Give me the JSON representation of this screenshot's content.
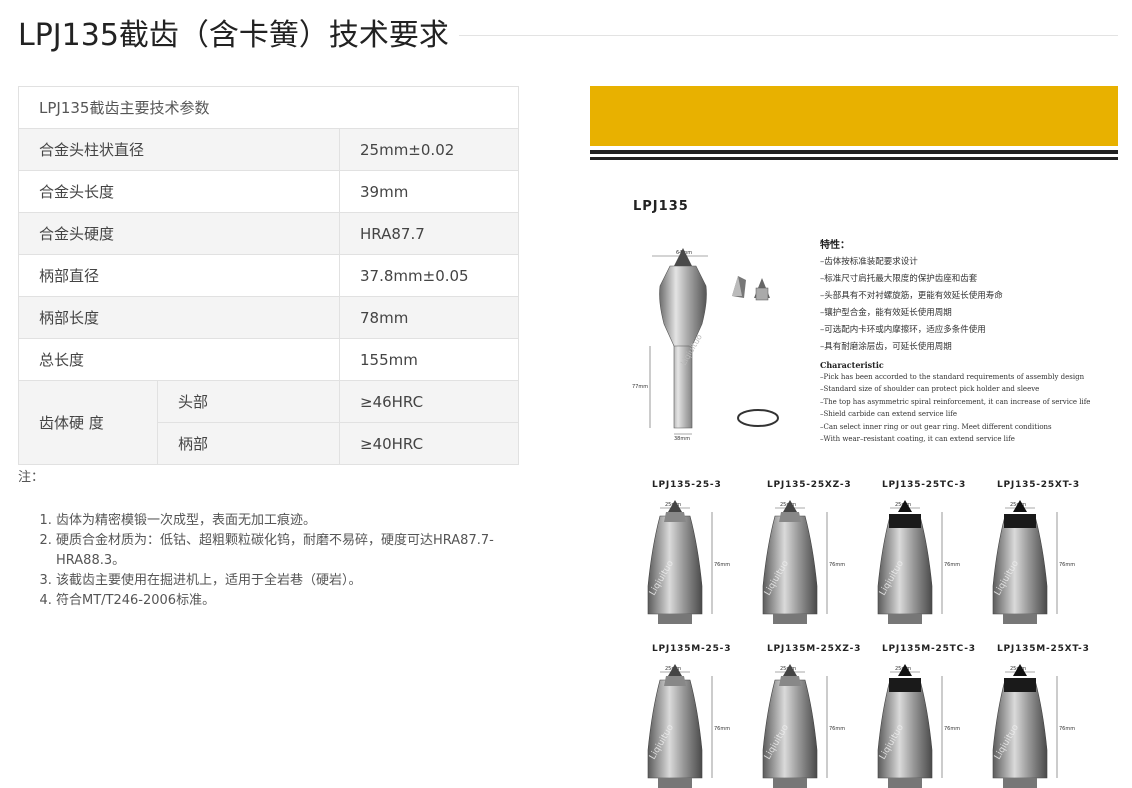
{
  "title": "LPJ135截齿（含卡簧）技术要求",
  "spec_table": {
    "header": "LPJ135截齿主要技术参数",
    "rows": [
      {
        "label": "合金头柱状直径",
        "value": "25mm±0.02"
      },
      {
        "label": "合金头长度",
        "value": "39mm"
      },
      {
        "label": "合金头硬度",
        "value": "HRA87.7"
      },
      {
        "label": "柄部直径",
        "value": "37.8mm±0.05"
      },
      {
        "label": "柄部长度",
        "value": "78mm"
      },
      {
        "label": "总长度",
        "value": "155mm"
      }
    ],
    "hardness": {
      "label": "齿体硬 度",
      "sub": [
        {
          "label": "头部",
          "value": "≥46HRC"
        },
        {
          "label": "柄部",
          "value": "≥40HRC"
        }
      ]
    }
  },
  "notes": {
    "label": "注：",
    "items": [
      "齿体为精密模锻一次成型，表面无加工痕迹。",
      "硬质合金材质为：低钴、超粗颗粒碳化钨，耐磨不易碎，硬度可达HRA87.7-HRA88.3。",
      "该截齿主要使用在掘进机上，适用于全岩巷（硬岩）。",
      "符合MT/T246-2006标准。"
    ]
  },
  "product_image": {
    "model": "LPJ135",
    "features_title": "特性：",
    "features": [
      "–齿体按标准装配要求设计",
      "–标准尺寸肩托最大限度的保护齿座和齿套",
      "–头部具有不对衬螺旋筋，更能有效延长使用寿命",
      "–镶护型合金，能有效延长使用周期",
      "–可选配内卡环或内摩擦环，适应多条件使用",
      "–具有耐磨涂层齿，可延长使用周期"
    ],
    "characteristic_title": "Characteristic",
    "characteristics": [
      "–Pick has been accorded to the standard requirements of assembly design",
      "–Standard size of shoulder can protect pick holder and sleeve",
      "–The top has asymmetric spiral reinforcement, it can increase of service life",
      "–Shield carbide can extend service life",
      "–Can select inner ring or out gear ring. Meet different conditions",
      "–With wear–resistant coating, it can extend service life"
    ],
    "dims": {
      "top": "64mm",
      "length": "77mm",
      "bottom": "38mm",
      "small_top": "25mm",
      "small_len": "76mm"
    },
    "watermark": "Liqiuituo",
    "variants_row1": [
      "LPJ135-25-3",
      "LPJ135-25XZ-3",
      "LPJ135-25TC-3",
      "LPJ135-25XT-3"
    ],
    "variants_row2": [
      "LPJ135M-25-3",
      "LPJ135M-25XZ-3",
      "LPJ135M-25TC-3",
      "LPJ135M-25XT-3"
    ]
  }
}
